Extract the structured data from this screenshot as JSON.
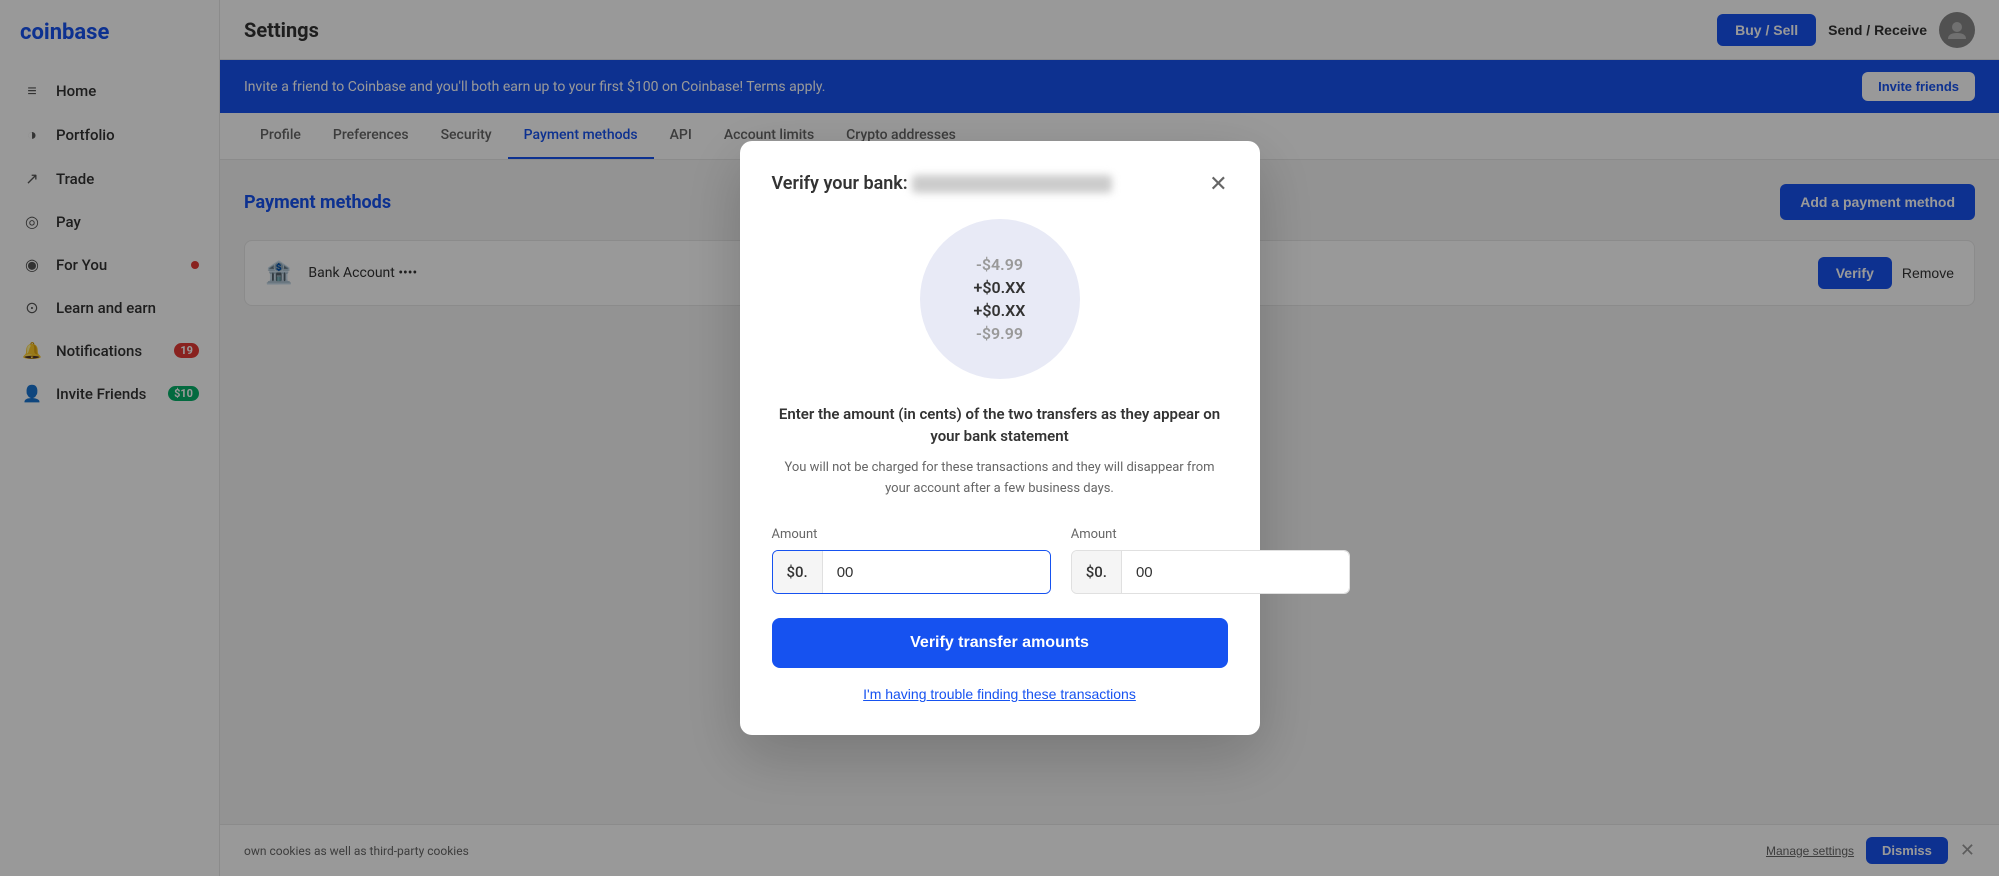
{
  "app": {
    "name": "coinbase",
    "logo": "coinbase"
  },
  "sidebar": {
    "items": [
      {
        "id": "home",
        "label": "Home",
        "icon": "≡",
        "badge": null
      },
      {
        "id": "portfolio",
        "label": "Portfolio",
        "icon": "◑",
        "badge": null
      },
      {
        "id": "trade",
        "label": "Trade",
        "icon": "↗",
        "badge": null
      },
      {
        "id": "pay",
        "label": "Pay",
        "icon": "◎",
        "badge": null
      },
      {
        "id": "for-you",
        "label": "For You",
        "icon": "◉",
        "badge": "dot"
      },
      {
        "id": "learn-and-earn",
        "label": "Learn and earn",
        "icon": "⊙",
        "badge": null
      },
      {
        "id": "notifications",
        "label": "Notifications",
        "icon": "🔔",
        "badge": "19"
      },
      {
        "id": "invite-friends",
        "label": "Invite Friends",
        "icon": "👤",
        "badge": "$10"
      }
    ]
  },
  "topbar": {
    "title": "Settings",
    "buy_sell_label": "Buy / Sell",
    "send_receive_label": "Send / Receive"
  },
  "banner": {
    "text": "Invite a friend to Coinbase and you'll both earn up to your first $100 on Coinbase! Terms apply.",
    "button_label": "Invite friends"
  },
  "settings_tabs": {
    "tabs": [
      {
        "id": "profile",
        "label": "Profile",
        "active": false
      },
      {
        "id": "preferences",
        "label": "Preferences",
        "active": false
      },
      {
        "id": "security",
        "label": "Security",
        "active": false
      },
      {
        "id": "payment-methods",
        "label": "Payment methods",
        "active": true
      },
      {
        "id": "api",
        "label": "API",
        "active": false
      },
      {
        "id": "account-limits",
        "label": "Account limits",
        "active": false
      },
      {
        "id": "crypto-addresses",
        "label": "Crypto addresses",
        "active": false
      }
    ]
  },
  "payment_methods": {
    "title": "Payment methods",
    "add_button": "Add a payment method",
    "bank_name": "Bank Account",
    "verify_button": "Verify",
    "remove_button": "Remove"
  },
  "modal": {
    "title_prefix": "Verify your bank:",
    "bank_name_placeholder": "••••••••••••••••••••••••",
    "circle_amounts": [
      "-$4.99",
      "+$0.XX",
      "+$0.XX",
      "-$9.99"
    ],
    "description_main": "Enter the amount (in cents) of the two transfers as\nthey appear on your bank statement",
    "description_sub": "You will not be charged for these transactions and they will\ndisappear from your account after a few business days.",
    "amount1_label": "Amount",
    "amount1_prefix": "$0.",
    "amount1_value": "00",
    "amount2_label": "Amount",
    "amount2_prefix": "$0.",
    "amount2_value": "00",
    "verify_button": "Verify transfer amounts",
    "trouble_link": "I'm having trouble finding these transactions"
  },
  "cookie_bar": {
    "text": "own cookies as well as third-party cookies",
    "manage_label": "Manage settings",
    "dismiss_label": "Dismiss"
  }
}
